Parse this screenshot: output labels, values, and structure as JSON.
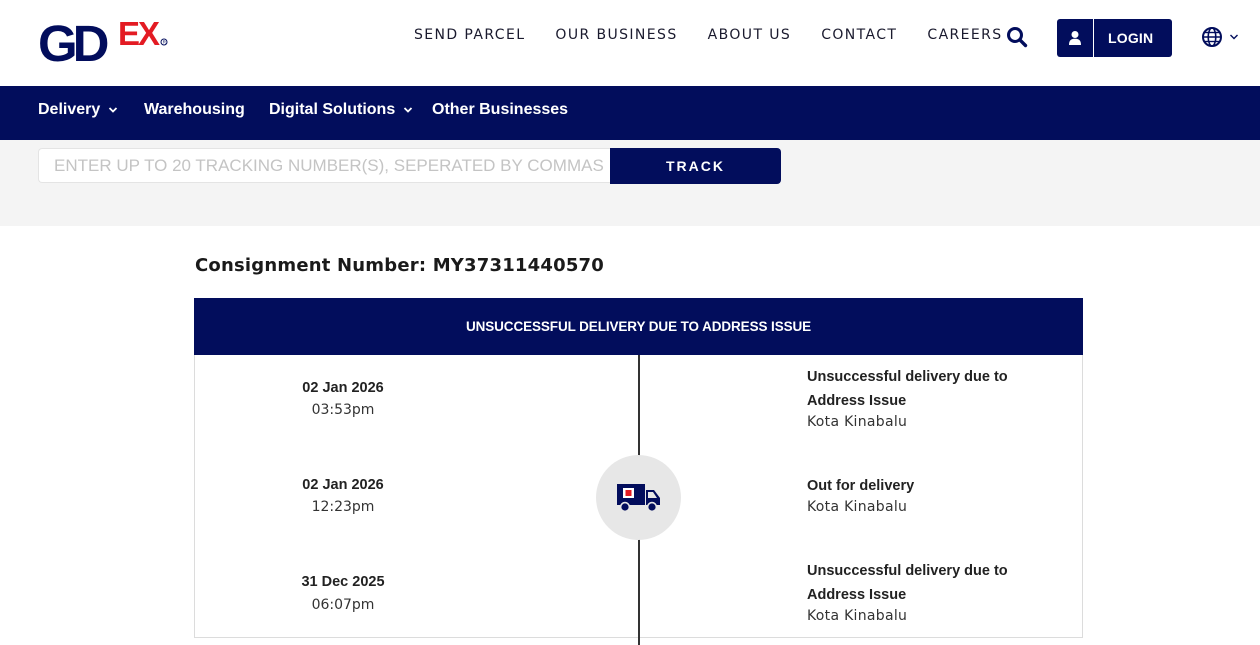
{
  "brand": {
    "logo_text": "GDEX",
    "colors": {
      "navy": "#020d5c",
      "red": "#e31b23",
      "band": "#f4f4f4"
    }
  },
  "top_nav": {
    "links": [
      "SEND PARCEL",
      "OUR BUSINESS",
      "ABOUT US",
      "CONTACT",
      "CAREERS"
    ],
    "search_icon": "search-icon",
    "login_label": "LOGIN",
    "language_icon": "globe-icon"
  },
  "main_nav": {
    "items": [
      {
        "label": "Delivery",
        "has_dropdown": true
      },
      {
        "label": "Warehousing",
        "has_dropdown": false
      },
      {
        "label": "Digital Solutions",
        "has_dropdown": true
      },
      {
        "label": "Other Businesses",
        "has_dropdown": false
      }
    ]
  },
  "tracking": {
    "placeholder": "ENTER UP TO 20 TRACKING NUMBER(S), SEPERATED BY COMMAS",
    "value": "",
    "button_label": "TRACK"
  },
  "consignment": {
    "text": "Consignment Number: MY37311440570",
    "status_header": "UNSUCCESSFUL DELIVERY DUE TO ADDRESS ISSUE"
  },
  "events": [
    {
      "date": "02 Jan 2026",
      "time": "03:53pm",
      "status": "Unsuccessful delivery due to Address Issue",
      "location": "Kota Kinabalu"
    },
    {
      "date": "02 Jan 2026",
      "time": "12:23pm",
      "status": "Out for delivery",
      "location": "Kota Kinabalu"
    },
    {
      "date": "31 Dec 2025",
      "time": "06:07pm",
      "status": "Unsuccessful delivery due to Address Issue",
      "location": "Kota Kinabalu"
    }
  ]
}
